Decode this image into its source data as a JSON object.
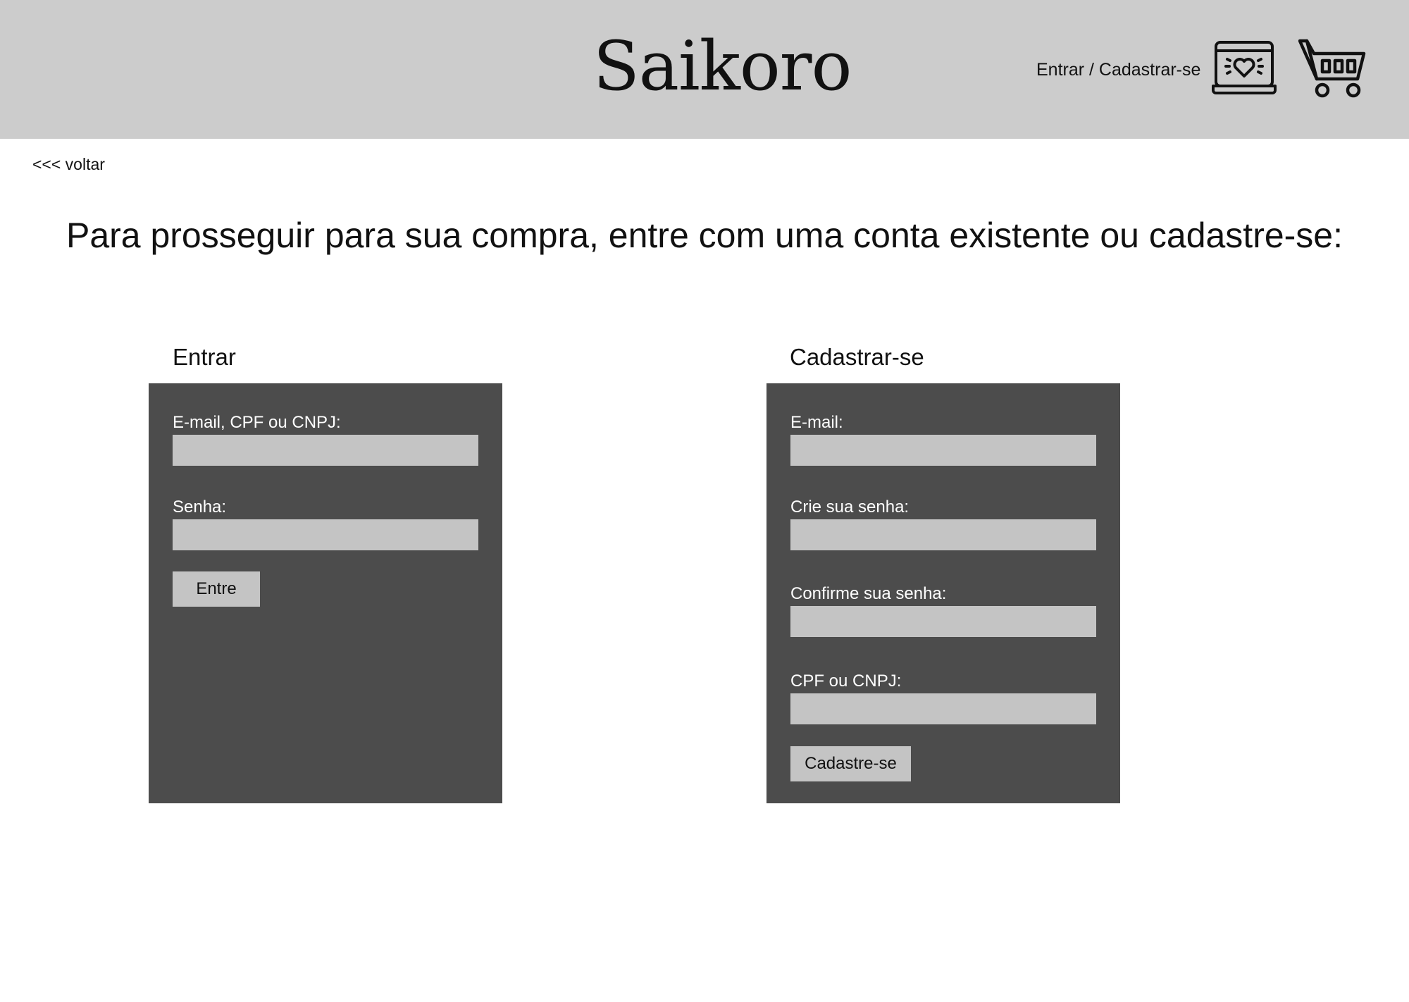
{
  "header": {
    "logo": "Saikoro",
    "auth_link": "Entrar / Cadastrar-se",
    "icons": [
      "wishlist-laptop-heart-icon",
      "shopping-cart-icon"
    ]
  },
  "nav": {
    "back_link": "<<< voltar"
  },
  "page": {
    "title": "Para prosseguir para sua compra, entre com uma conta existente ou cadastre-se:"
  },
  "login": {
    "title": "Entrar",
    "fields": [
      {
        "label": "E-mail, CPF ou CNPJ:",
        "value": ""
      },
      {
        "label": "Senha:",
        "value": ""
      }
    ],
    "submit_label": "Entre"
  },
  "signup": {
    "title": "Cadastrar-se",
    "fields": [
      {
        "label": "E-mail:",
        "value": ""
      },
      {
        "label": "Crie sua senha:",
        "value": ""
      },
      {
        "label": "Confirme sua senha:",
        "value": ""
      },
      {
        "label": "CPF ou CNPJ:",
        "value": ""
      }
    ],
    "submit_label": "Cadastre-se"
  },
  "colors": {
    "header_bg": "#cccccc",
    "panel_bg": "#4c4c4c",
    "input_bg": "#c4c4c4",
    "page_bg": "#ffffff"
  }
}
